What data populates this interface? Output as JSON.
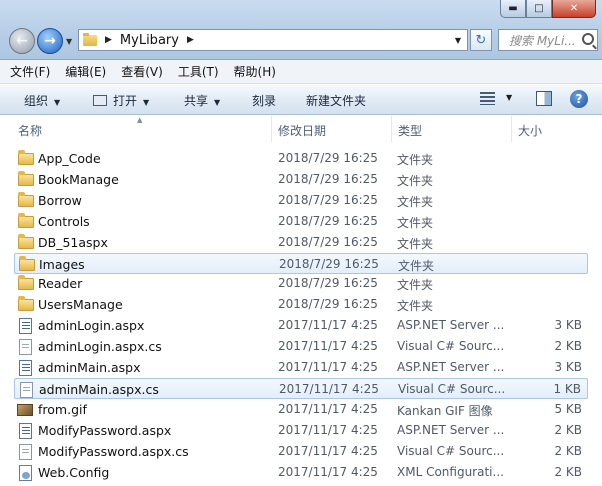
{
  "window": {
    "buttons": {
      "minimize": "▬",
      "maximize": "□",
      "close": "✕"
    }
  },
  "address_bar": {
    "crumbs": [
      "MyLibary"
    ],
    "search_placeholder": "搜索 MyLi..."
  },
  "menu": [
    "文件(F)",
    "编辑(E)",
    "查看(V)",
    "工具(T)",
    "帮助(H)"
  ],
  "toolbar": {
    "organize": "组织",
    "open": "打开",
    "share": "共享",
    "burn": "刻录",
    "new_folder": "新建文件夹",
    "help": "?"
  },
  "columns": {
    "name": "名称",
    "date": "修改日期",
    "type": "类型",
    "size": "大小"
  },
  "files": [
    {
      "name": "App_Code",
      "date": "2018/7/29 16:25",
      "type": "文件夹",
      "size": "",
      "icon": "folder-icon",
      "selected": false
    },
    {
      "name": "BookManage",
      "date": "2018/7/29 16:25",
      "type": "文件夹",
      "size": "",
      "icon": "folder-icon",
      "selected": false
    },
    {
      "name": "Borrow",
      "date": "2018/7/29 16:25",
      "type": "文件夹",
      "size": "",
      "icon": "folder-icon",
      "selected": false
    },
    {
      "name": "Controls",
      "date": "2018/7/29 16:25",
      "type": "文件夹",
      "size": "",
      "icon": "folder-icon",
      "selected": false
    },
    {
      "name": "DB_51aspx",
      "date": "2018/7/29 16:25",
      "type": "文件夹",
      "size": "",
      "icon": "folder-icon",
      "selected": false
    },
    {
      "name": "Images",
      "date": "2018/7/29 16:25",
      "type": "文件夹",
      "size": "",
      "icon": "folder-icon",
      "selected": true
    },
    {
      "name": "Reader",
      "date": "2018/7/29 16:25",
      "type": "文件夹",
      "size": "",
      "icon": "folder-icon",
      "selected": false
    },
    {
      "name": "UsersManage",
      "date": "2018/7/29 16:25",
      "type": "文件夹",
      "size": "",
      "icon": "folder-icon",
      "selected": false
    },
    {
      "name": "adminLogin.aspx",
      "date": "2017/11/17 4:25",
      "type": "ASP.NET Server ...",
      "size": "3 KB",
      "icon": "aspx-file-icon",
      "selected": false
    },
    {
      "name": "adminLogin.aspx.cs",
      "date": "2017/11/17 4:25",
      "type": "Visual C# Sourc...",
      "size": "2 KB",
      "icon": "cs-file-icon",
      "selected": false
    },
    {
      "name": "adminMain.aspx",
      "date": "2017/11/17 4:25",
      "type": "ASP.NET Server ...",
      "size": "3 KB",
      "icon": "aspx-file-icon",
      "selected": false
    },
    {
      "name": "adminMain.aspx.cs",
      "date": "2017/11/17 4:25",
      "type": "Visual C# Sourc...",
      "size": "1 KB",
      "icon": "cs-file-icon",
      "selected": true
    },
    {
      "name": "from.gif",
      "date": "2017/11/17 4:25",
      "type": "Kankan GIF 图像",
      "size": "5 KB",
      "icon": "gif-file-icon",
      "selected": false
    },
    {
      "name": "ModifyPassword.aspx",
      "date": "2017/11/17 4:25",
      "type": "ASP.NET Server ...",
      "size": "2 KB",
      "icon": "aspx-file-icon",
      "selected": false
    },
    {
      "name": "ModifyPassword.aspx.cs",
      "date": "2017/11/17 4:25",
      "type": "Visual C# Sourc...",
      "size": "2 KB",
      "icon": "cs-file-icon",
      "selected": false
    },
    {
      "name": "Web.Config",
      "date": "2017/11/17 4:25",
      "type": "XML Configurati...",
      "size": "2 KB",
      "icon": "config-file-icon",
      "selected": false
    }
  ]
}
